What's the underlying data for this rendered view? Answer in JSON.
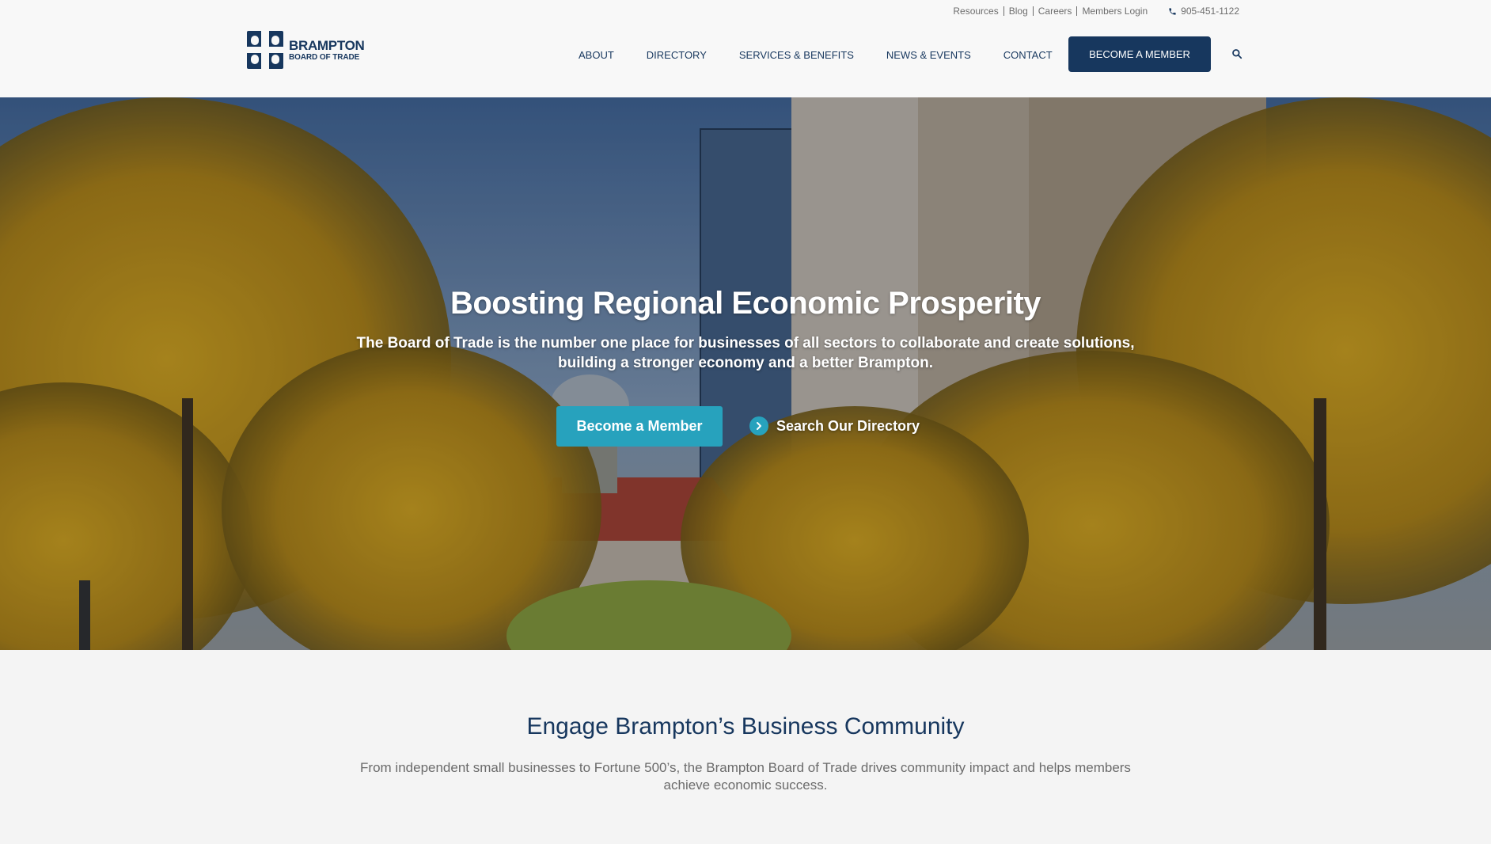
{
  "utility_nav": {
    "links": [
      "Resources",
      "Blog",
      "Careers",
      "Members Login"
    ],
    "phone": "905-451-1122"
  },
  "logo": {
    "line1": "BRAMPTON",
    "line2": "BOARD OF TRADE"
  },
  "main_nav": {
    "items": [
      "ABOUT",
      "DIRECTORY",
      "SERVICES & BENEFITS",
      "NEWS & EVENTS",
      "CONTACT"
    ],
    "cta": "BECOME A MEMBER",
    "search_icon": "search-icon"
  },
  "hero": {
    "title": "Boosting Regional Economic Prosperity",
    "subtitle": "The Board of Trade is the number one place for businesses of all sectors to collaborate and create solutions, building a stronger economy and a better Brampton.",
    "primary_button": "Become a Member",
    "secondary_link": "Search Our Directory"
  },
  "engage": {
    "title": "Engage Brampton’s Business Community",
    "text": "From independent small businesses to Fortune 500’s, the Brampton Board of Trade drives community impact and helps members achieve economic success."
  },
  "colors": {
    "brand_navy": "#17375e",
    "accent_teal": "#27a2bd",
    "muted_text": "#6b6b6b"
  }
}
